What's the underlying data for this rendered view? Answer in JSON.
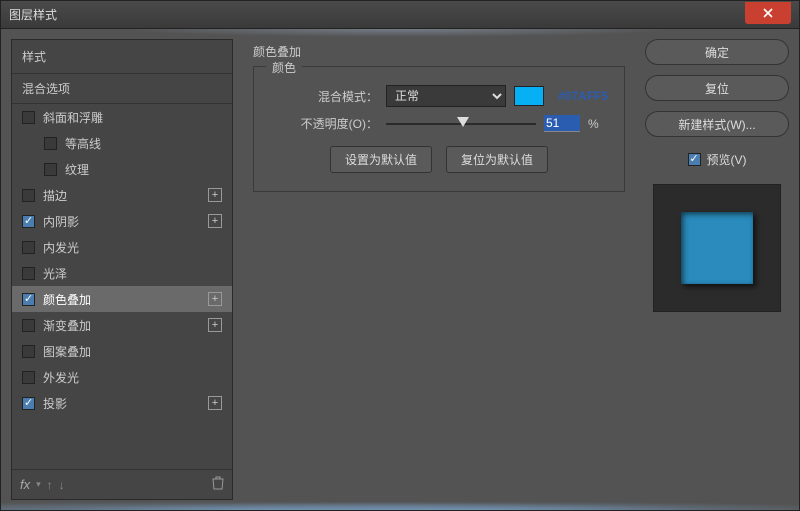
{
  "window": {
    "title": "图层样式"
  },
  "left": {
    "styles_label": "样式",
    "blend_options_label": "混合选项",
    "items": [
      {
        "label": "斜面和浮雕",
        "checked": false,
        "plus": false
      },
      {
        "label": "等高线",
        "checked": false,
        "plus": false,
        "indent": true
      },
      {
        "label": "纹理",
        "checked": false,
        "plus": false,
        "indent": true
      },
      {
        "label": "描边",
        "checked": false,
        "plus": true
      },
      {
        "label": "内阴影",
        "checked": true,
        "plus": true
      },
      {
        "label": "内发光",
        "checked": false,
        "plus": false
      },
      {
        "label": "光泽",
        "checked": false,
        "plus": false
      },
      {
        "label": "颜色叠加",
        "checked": true,
        "plus": true,
        "selected": true
      },
      {
        "label": "渐变叠加",
        "checked": false,
        "plus": true
      },
      {
        "label": "图案叠加",
        "checked": false,
        "plus": false
      },
      {
        "label": "外发光",
        "checked": false,
        "plus": false
      },
      {
        "label": "投影",
        "checked": true,
        "plus": true
      }
    ],
    "fx_label": "fx"
  },
  "center": {
    "section_title": "颜色叠加",
    "legend": "颜色",
    "blend_mode_label": "混合模式：",
    "blend_mode_value": "正常",
    "hex": "#07AFF5",
    "opacity_label": "不透明度(O)：",
    "opacity_value": "51",
    "opacity_unit": "%",
    "set_default": "设置为默认值",
    "reset_default": "复位为默认值"
  },
  "right": {
    "ok": "确定",
    "reset": "复位",
    "new_style": "新建样式(W)...",
    "preview_label": "预览(V)",
    "preview_checked": true
  },
  "colors": {
    "swatch": "#07AFF5"
  }
}
